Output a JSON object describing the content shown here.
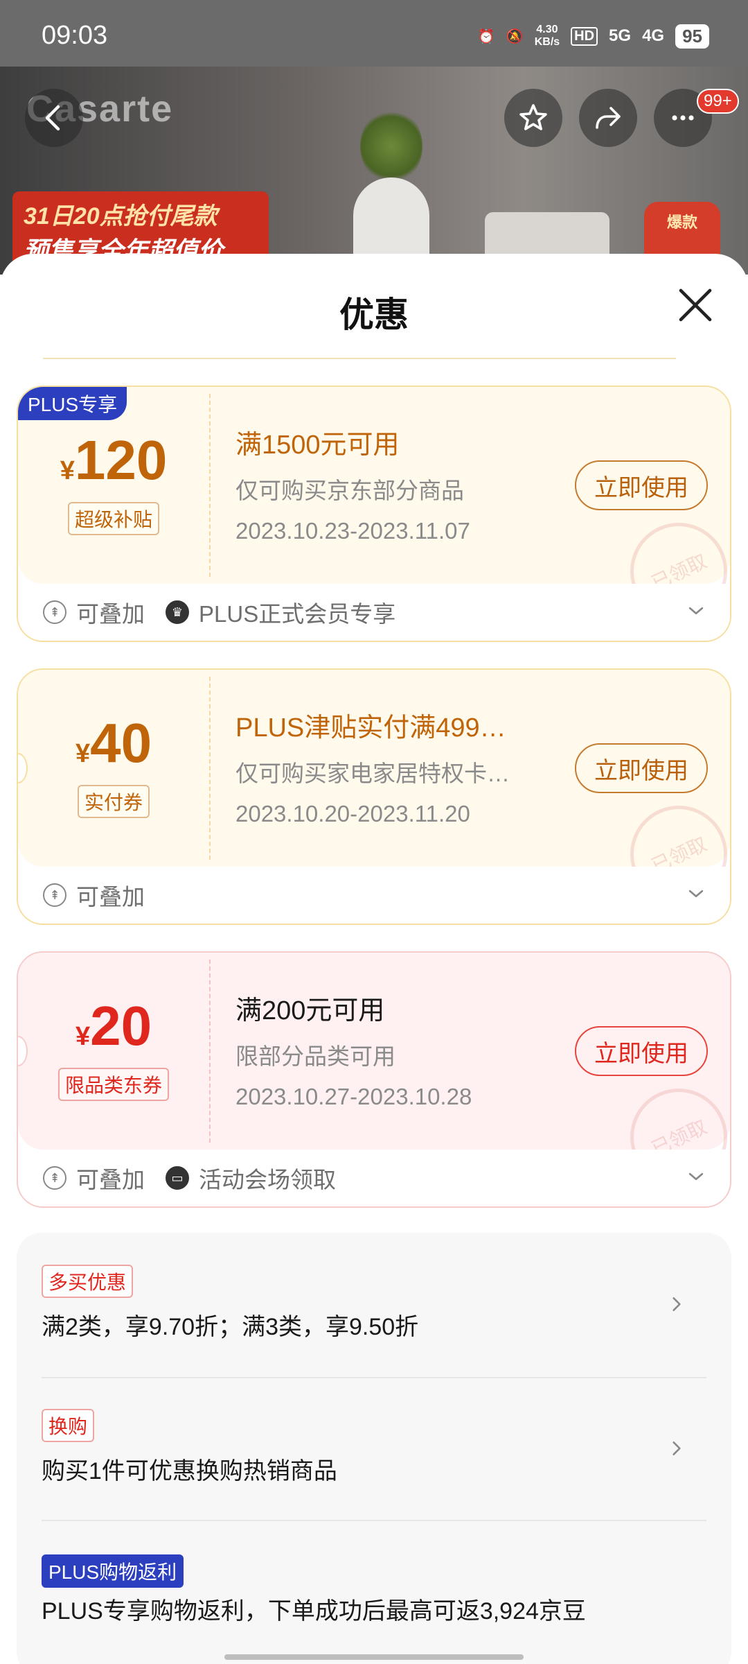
{
  "status_bar": {
    "time": "09:03",
    "net_speed": "4.30",
    "net_unit": "KB/s",
    "hd": "HD",
    "signal1": "5G",
    "signal2": "4G",
    "battery": "95"
  },
  "banner": {
    "brand": "Casarte",
    "promo_line1": "31日20点抢付尾款",
    "promo_line2": "预售享全年超值价",
    "corner_label": "爆款",
    "cart_badge": "99+"
  },
  "sheet": {
    "title": "优惠"
  },
  "coupons": [
    {
      "badge": "PLUS专享",
      "currency": "¥",
      "amount": "120",
      "tag": "超级补贴",
      "title": "满1500元可用",
      "scope": "仅可购买京东部分商品",
      "period": "2023.10.23-2023.11.07",
      "button": "立即使用",
      "stamp": "已领取",
      "footer": [
        {
          "icon": "stack-icon",
          "text": "可叠加"
        },
        {
          "icon": "crown-icon",
          "text": "PLUS正式会员专享"
        }
      ]
    },
    {
      "badge": "",
      "currency": "¥",
      "amount": "40",
      "tag": "实付券",
      "title": "PLUS津贴实付满499…",
      "scope": "仅可购买家电家居特权卡…",
      "period": "2023.10.20-2023.11.20",
      "button": "立即使用",
      "stamp": "已领取",
      "footer": [
        {
          "icon": "stack-icon",
          "text": "可叠加"
        }
      ]
    },
    {
      "badge": "",
      "currency": "¥",
      "amount": "20",
      "tag": "限品类东券",
      "title": "满200元可用",
      "scope": "限部分品类可用",
      "period": "2023.10.27-2023.10.28",
      "button": "立即使用",
      "stamp": "已领取",
      "footer": [
        {
          "icon": "stack-icon",
          "text": "可叠加"
        },
        {
          "icon": "ticket-icon",
          "text": "活动会场领取"
        }
      ]
    }
  ],
  "promotions": [
    {
      "tag": "多买优惠",
      "text": "满2类，享9.70折；满3类，享9.50折"
    },
    {
      "tag": "换购",
      "text": "购买1件可优惠换购热销商品"
    },
    {
      "tag": "PLUS购物返利",
      "text": "PLUS专享购物返利，下单成功后最高可返3,924京豆"
    }
  ],
  "colors": {
    "orange_accent": "#c0640a",
    "red_accent": "#e0271e",
    "plus_blue": "#2c3fbf"
  }
}
